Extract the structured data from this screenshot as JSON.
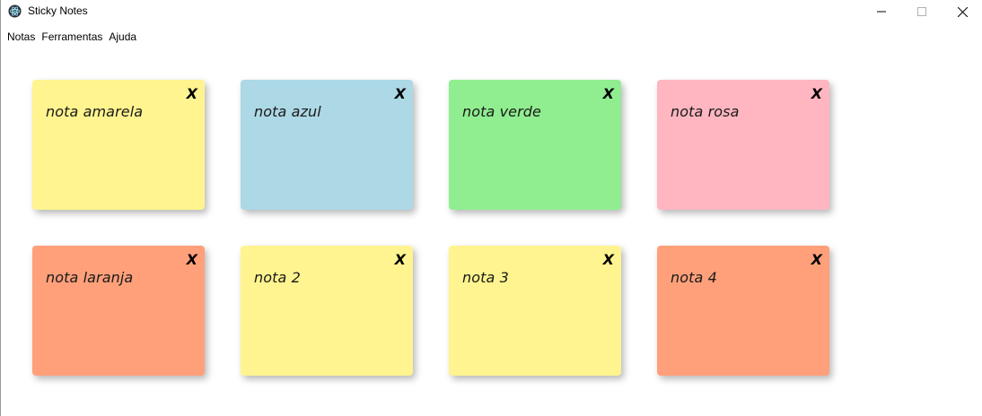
{
  "window": {
    "title": "Sticky Notes",
    "app_icon": "atom-icon",
    "controls": [
      "minimize-icon",
      "maximize-icon",
      "close-icon"
    ]
  },
  "menu": {
    "items": [
      {
        "label": "Notas"
      },
      {
        "label": "Ferramentas"
      },
      {
        "label": "Ajuda"
      }
    ]
  },
  "notes": [
    {
      "text": "nota amarela",
      "color": "#fff48f",
      "close_label": "X"
    },
    {
      "text": "nota azul",
      "color": "#add8e6",
      "close_label": "X"
    },
    {
      "text": "nota verde",
      "color": "#90ee90",
      "close_label": "X"
    },
    {
      "text": "nota rosa",
      "color": "#ffb6c1",
      "close_label": "X"
    },
    {
      "text": "nota laranja",
      "color": "#ffa07a",
      "close_label": "X"
    },
    {
      "text": "nota 2",
      "color": "#fff48f",
      "close_label": "X"
    },
    {
      "text": "nota 3",
      "color": "#fff48f",
      "close_label": "X"
    },
    {
      "text": "nota 4",
      "color": "#ffa07a",
      "close_label": "X"
    }
  ]
}
